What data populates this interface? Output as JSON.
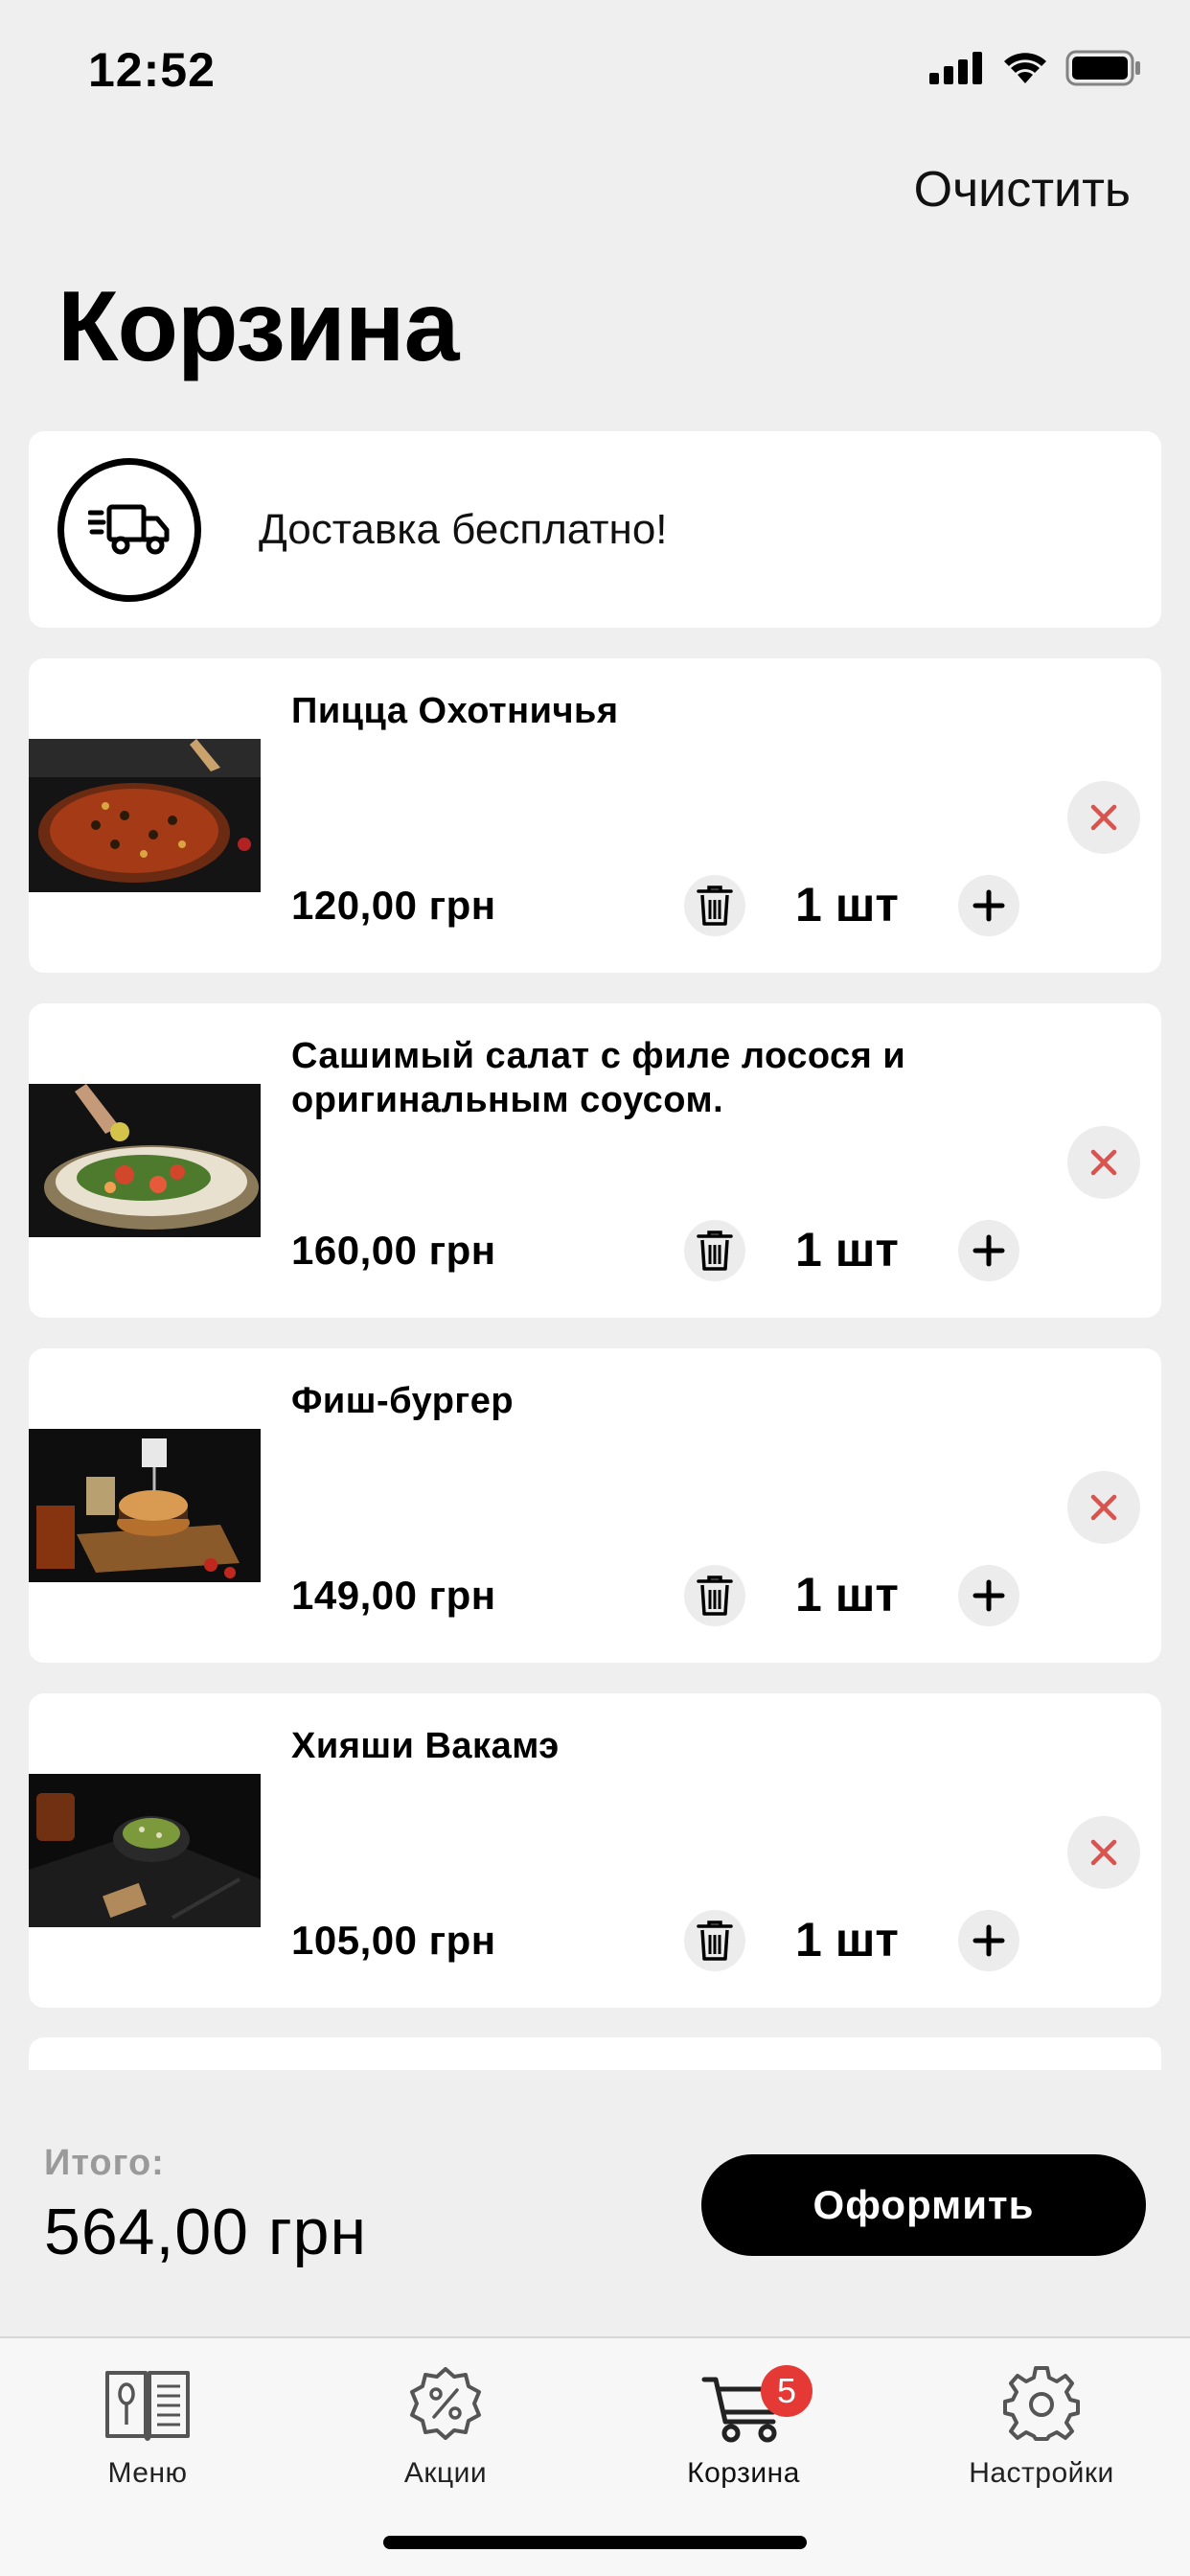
{
  "status": {
    "time": "12:52"
  },
  "header": {
    "clear_label": "Очистить",
    "title": "Корзина"
  },
  "delivery": {
    "text": "Доставка бесплатно!"
  },
  "items": [
    {
      "name": "Пицца Охотничья",
      "price": "120,00 грн",
      "qty": "1 шт",
      "photo": "pizza"
    },
    {
      "name": "Сашимый салат с филе лосося и оригинальным соусом.",
      "price": "160,00 грн",
      "qty": "1 шт",
      "photo": "salad"
    },
    {
      "name": "Фиш-бургер",
      "price": "149,00 грн",
      "qty": "1 шт",
      "photo": "burger"
    },
    {
      "name": "Хияши Вакамэ",
      "price": "105,00 грн",
      "qty": "1 шт",
      "photo": "seaweed-salad"
    }
  ],
  "summary": {
    "total_label": "Итого:",
    "total_value": "564,00 грн",
    "checkout_label": "Оформить"
  },
  "tabs": [
    {
      "label": "Меню",
      "icon": "menu-book-icon"
    },
    {
      "label": "Акции",
      "icon": "discount-badge-icon"
    },
    {
      "label": "Корзина",
      "icon": "cart-icon",
      "badge": "5",
      "active": true
    },
    {
      "label": "Настройки",
      "icon": "gear-icon"
    }
  ],
  "colors": {
    "accent": "#000000",
    "badge": "#e53935",
    "remove_x": "#d9534f",
    "background": "#efefef"
  }
}
